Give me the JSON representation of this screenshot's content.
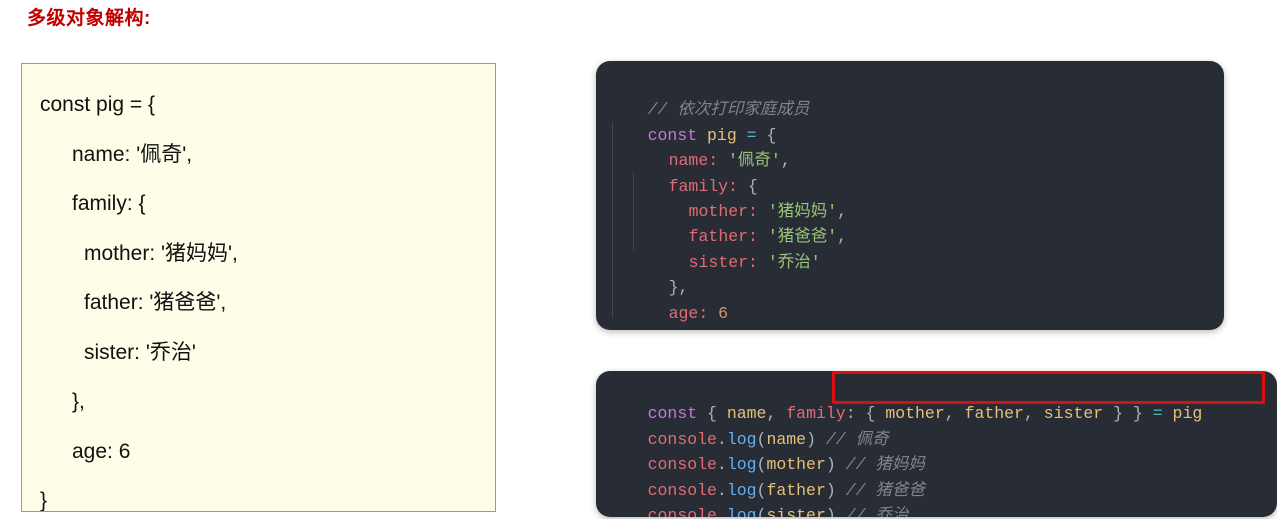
{
  "page": {
    "title": "多级对象解构:",
    "title_color": "#c00000",
    "background": "#ffffff"
  },
  "left_panel": {
    "name": "plain-code-panel",
    "background": "#fdfde8",
    "border_color": "#9a9a8e",
    "lines": [
      "const pig = {",
      "name: '佩奇',",
      "family: {",
      "mother: '猪妈妈',",
      "father: '猪爸爸',",
      "sister: '乔治'",
      "},",
      "age: 6",
      "}"
    ]
  },
  "top_code_block": {
    "name": "object-definition-code-block",
    "background": "#282c34",
    "lines": [
      {
        "comment": "// 依次打印家庭成员"
      },
      {
        "kw": "const",
        "var": "pig",
        "op": "=",
        "pun": "{"
      },
      {
        "prop": "name:",
        "str": "'佩奇'",
        "pun": ","
      },
      {
        "prop": "family:",
        "pun": "{"
      },
      {
        "prop": "mother:",
        "str": "'猪妈妈'",
        "pun": ","
      },
      {
        "prop": "father:",
        "str": "'猪爸爸'",
        "pun": ","
      },
      {
        "prop": "sister:",
        "str": "'乔治'"
      },
      {
        "pun": "},"
      },
      {
        "prop": "age:",
        "num": "6"
      },
      {
        "pun": "}"
      }
    ],
    "ghost_line": {
      "prop": "age:",
      "num": "6"
    }
  },
  "bottom_code_block": {
    "name": "destructuring-code-block",
    "background": "#282c34",
    "destructure_line": {
      "kw": "const",
      "open": "{",
      "name_tok": "name",
      "comma1": ",",
      "family_tok": "family",
      "colon": ":",
      "inner_open": "{",
      "mother_tok": "mother",
      "comma2": ",",
      "father_tok": "father",
      "comma3": ",",
      "sister_tok": "sister",
      "inner_close": "}",
      "outer_close": "}",
      "eq": "=",
      "source": "pig"
    },
    "log_lines": [
      {
        "obj": "console",
        "dot": ".",
        "fn": "log",
        "open": "(",
        "arg": "name",
        "close": ")",
        "comment": "// 佩奇"
      },
      {
        "obj": "console",
        "dot": ".",
        "fn": "log",
        "open": "(",
        "arg": "mother",
        "close": ")",
        "comment": "// 猪妈妈"
      },
      {
        "obj": "console",
        "dot": ".",
        "fn": "log",
        "open": "(",
        "arg": "father",
        "close": ")",
        "comment": "// 猪爸爸"
      },
      {
        "obj": "console",
        "dot": ".",
        "fn": "log",
        "open": "(",
        "arg": "sister",
        "close": ")",
        "comment": "// 乔治"
      }
    ]
  },
  "highlight": {
    "name": "red-emphasis-box",
    "color": "#d81010",
    "target": "nested destructuring pattern"
  }
}
